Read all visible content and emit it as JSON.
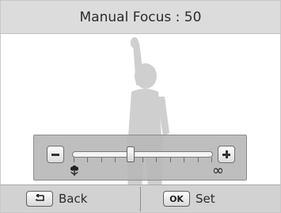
{
  "title_bar": {
    "title": "Manual Focus : 50"
  },
  "focus_slider": {
    "value": 50,
    "minus_icon": "minus-icon",
    "plus_icon": "plus-icon",
    "near_icon": "macro-flower-icon",
    "far_icon": "infinity-icon",
    "far_symbol": "∞"
  },
  "bottom_bar": {
    "back": {
      "icon": "back-arrow-icon",
      "label": "Back"
    },
    "set": {
      "key": "OK",
      "label": "Set"
    }
  },
  "colors": {
    "title_bg": "#dcdcdc",
    "panel_bg": "#b9b9b9",
    "bottom_bg": "#d2d2d2",
    "silhouette": "#cfcfcf"
  }
}
